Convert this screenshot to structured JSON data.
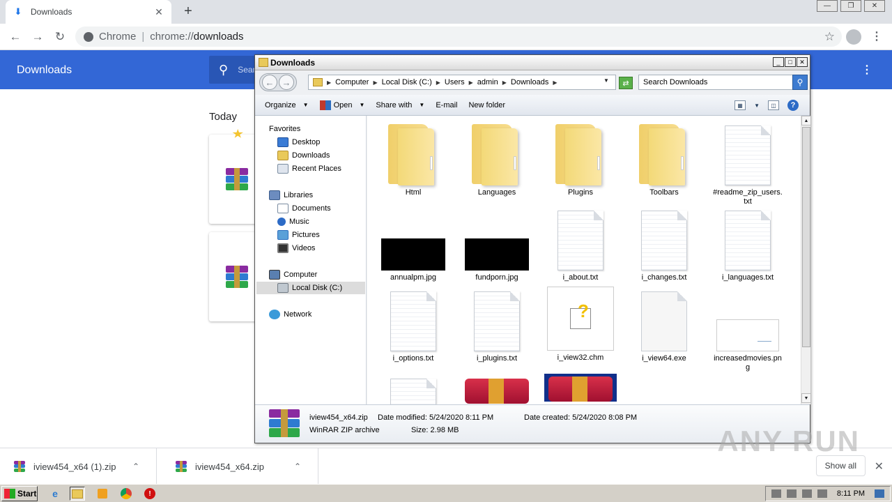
{
  "chrome": {
    "tab_title": "Downloads",
    "new_tab_label": "+",
    "omnibox_site": "Chrome",
    "omnibox_separator": "|",
    "omnibox_scheme": "chrome://",
    "omnibox_path": "downloads",
    "colors": {
      "header": "#3367d6",
      "accent": "#1a73e8"
    }
  },
  "downloads_page": {
    "title": "Downloads",
    "search_placeholder": "Search downloads",
    "section_today": "Today"
  },
  "explorer": {
    "title": "Downloads",
    "breadcrumbs": [
      "Computer",
      "Local Disk (C:)",
      "Users",
      "admin",
      "Downloads"
    ],
    "search_placeholder": "Search Downloads",
    "commands": [
      "Organize",
      "Open",
      "Share with",
      "E-mail",
      "New folder"
    ],
    "nav": {
      "favorites": "Favorites",
      "desktop": "Desktop",
      "downloads": "Downloads",
      "recent_places": "Recent Places",
      "libraries": "Libraries",
      "documents": "Documents",
      "music": "Music",
      "pictures": "Pictures",
      "videos": "Videos",
      "computer": "Computer",
      "local_disk": "Local Disk (C:)",
      "network": "Network"
    },
    "files": [
      {
        "name": "Html",
        "kind": "folder"
      },
      {
        "name": "Languages",
        "kind": "folder"
      },
      {
        "name": "Plugins",
        "kind": "folder"
      },
      {
        "name": "Toolbars",
        "kind": "folder"
      },
      {
        "name": "#readme_zip_users.txt",
        "kind": "txt"
      },
      {
        "name": "annualpm.jpg",
        "kind": "image"
      },
      {
        "name": "fundporn.jpg",
        "kind": "image"
      },
      {
        "name": "i_about.txt",
        "kind": "txt"
      },
      {
        "name": "i_changes.txt",
        "kind": "txt"
      },
      {
        "name": "i_languages.txt",
        "kind": "txt"
      },
      {
        "name": "i_options.txt",
        "kind": "txt"
      },
      {
        "name": "i_plugins.txt",
        "kind": "txt"
      },
      {
        "name": "i_view32.chm",
        "kind": "chm"
      },
      {
        "name": "i_view64.exe",
        "kind": "exe"
      },
      {
        "name": "increasedmovies.png",
        "kind": "png"
      }
    ],
    "details": {
      "name": "iview454_x64.zip",
      "type": "WinRAR ZIP archive",
      "modified_label": "Date modified:",
      "modified": "5/24/2020 8:11 PM",
      "size_label": "Size:",
      "size": "2.98 MB",
      "created_label": "Date created:",
      "created": "5/24/2020 8:08 PM"
    }
  },
  "shelf": {
    "items": [
      {
        "name": "iview454_x64 (1).zip"
      },
      {
        "name": "iview454_x64.zip"
      }
    ],
    "show_all": "Show all",
    "watermark": "ANY RUN"
  },
  "taskbar": {
    "start": "Start",
    "clock": "8:11 PM"
  }
}
